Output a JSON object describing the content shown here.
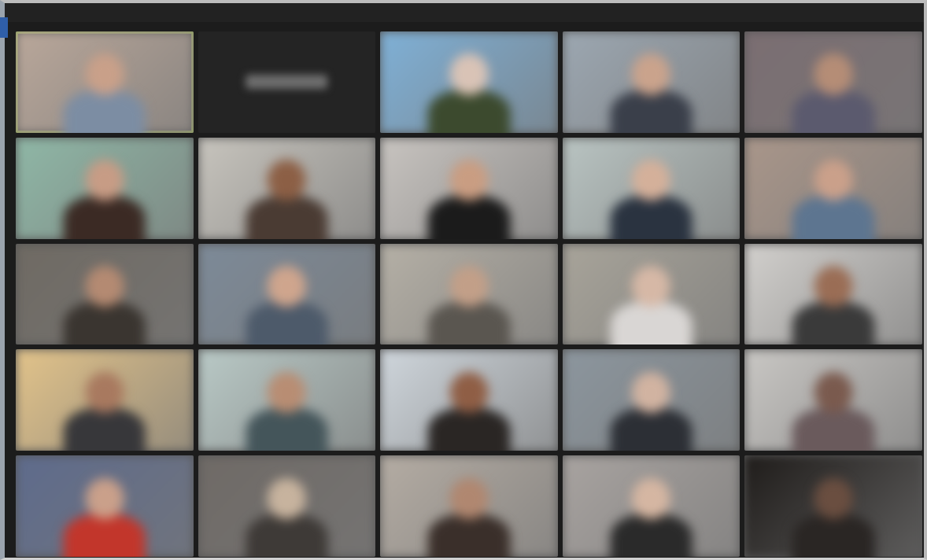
{
  "window": {
    "title": ""
  },
  "view": {
    "mode": "gallery",
    "columns": 5,
    "rows": 5,
    "active_speaker_index": 0
  },
  "participants": [
    {
      "name": "",
      "video": true,
      "bg": "#b9a79a",
      "skin": "#c9a089",
      "shirt": "#7c8da3",
      "active": true
    },
    {
      "name": "",
      "video": false,
      "bg": "#242424",
      "skin": "#242424",
      "shirt": "#242424"
    },
    {
      "name": "",
      "video": true,
      "bg": "#7fb0d6",
      "skin": "#d9c3b6",
      "shirt": "#3c4a2e"
    },
    {
      "name": "",
      "video": true,
      "bg": "#9ca7b1",
      "skin": "#caa38c",
      "shirt": "#3a3f4a"
    },
    {
      "name": "",
      "video": true,
      "bg": "#7b6e72",
      "skin": "#b58d76",
      "shirt": "#5b5a6e"
    },
    {
      "name": "",
      "video": true,
      "bg": "#8fb7a6",
      "skin": "#c79c85",
      "shirt": "#3b2a24"
    },
    {
      "name": "",
      "video": true,
      "bg": "#c7c4bd",
      "skin": "#8c5f45",
      "shirt": "#4a3b33"
    },
    {
      "name": "",
      "video": true,
      "bg": "#c8c4c0",
      "skin": "#c99d82",
      "shirt": "#1b1b1b"
    },
    {
      "name": "",
      "video": true,
      "bg": "#b9c4c2",
      "skin": "#d4b09a",
      "shirt": "#2a3340"
    },
    {
      "name": "",
      "video": true,
      "bg": "#a9968a",
      "skin": "#caa08a",
      "shirt": "#5d7590"
    },
    {
      "name": "",
      "video": true,
      "bg": "#6f6a63",
      "skin": "#b48a72",
      "shirt": "#3a3530"
    },
    {
      "name": "",
      "video": true,
      "bg": "#7d8a98",
      "skin": "#cfa58d",
      "shirt": "#4d5a6a"
    },
    {
      "name": "",
      "video": true,
      "bg": "#b5b0a6",
      "skin": "#c29f88",
      "shirt": "#5a5650"
    },
    {
      "name": "",
      "video": true,
      "bg": "#a8a49a",
      "skin": "#d6b8a6",
      "shirt": "#d9d6d4"
    },
    {
      "name": "",
      "video": true,
      "bg": "#d2d0cd",
      "skin": "#9a6d55",
      "shirt": "#3a3a3a"
    },
    {
      "name": "",
      "video": true,
      "bg": "#e2c38a",
      "skin": "#a8795f",
      "shirt": "#37373a"
    },
    {
      "name": "",
      "video": true,
      "bg": "#b9c9c6",
      "skin": "#b88d73",
      "shirt": "#44555a"
    },
    {
      "name": "",
      "video": true,
      "bg": "#cfd6dc",
      "skin": "#8f5e45",
      "shirt": "#2a2624"
    },
    {
      "name": "",
      "video": true,
      "bg": "#8c969e",
      "skin": "#d1b3a1",
      "shirt": "#2c2f35"
    },
    {
      "name": "",
      "video": true,
      "bg": "#c9c7c4",
      "skin": "#7a5a4e",
      "shirt": "#6a5a5c"
    },
    {
      "name": "",
      "video": true,
      "bg": "#5e6b8c",
      "skin": "#caa08a",
      "shirt": "#c2362b"
    },
    {
      "name": "",
      "video": true,
      "bg": "#6f6a66",
      "skin": "#c7b39e",
      "shirt": "#3e3a37"
    },
    {
      "name": "",
      "video": true,
      "bg": "#b4aca3",
      "skin": "#b08770",
      "shirt": "#3a2f2a"
    },
    {
      "name": "",
      "video": true,
      "bg": "#a8a3a0",
      "skin": "#d5b6a2",
      "shirt": "#2a2a2a"
    },
    {
      "name": "",
      "video": true,
      "bg": "#1f1c1a",
      "skin": "#6a4e40",
      "shirt": "#2a2624"
    }
  ]
}
